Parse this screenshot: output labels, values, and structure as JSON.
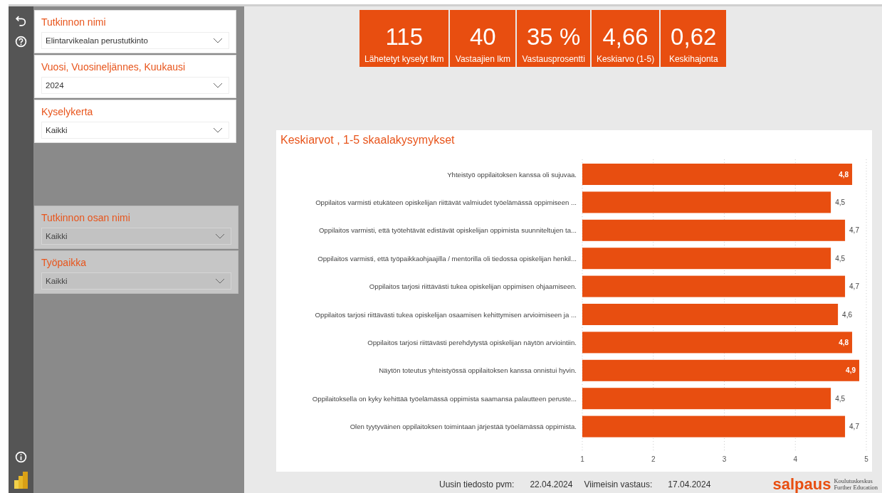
{
  "filters": {
    "top": [
      {
        "title": "Tutkinnon nimi",
        "value": "Elintarvikealan perustutkinto",
        "disabled": false
      },
      {
        "title": "Vuosi, Vuosineljännes, Kuukausi",
        "value": "2024",
        "disabled": false
      },
      {
        "title": "Kyselykerta",
        "value": "Kaikki",
        "disabled": false
      }
    ],
    "bottom": [
      {
        "title": "Tutkinnon osan nimi",
        "value": "Kaikki",
        "disabled": true
      },
      {
        "title": "Työpaikka",
        "value": "Kaikki",
        "disabled": true
      }
    ]
  },
  "kpis": [
    {
      "value": "115",
      "label": "Lähetetyt kyselyt lkm"
    },
    {
      "value": "40",
      "label": "Vastaajien lkm"
    },
    {
      "value": "35 %",
      "label": "Vastausprosentti"
    },
    {
      "value": "4,66",
      "label": "Keskiarvo (1-5)"
    },
    {
      "value": "0,62",
      "label": "Keskihajonta"
    }
  ],
  "chart": {
    "title": "Keskiarvot , 1-5 skaalakysymykset",
    "chart_data": {
      "type": "bar",
      "orientation": "horizontal",
      "grid": true,
      "xlim": [
        1,
        5
      ],
      "xticks": [
        1,
        2,
        3,
        4,
        5
      ],
      "categories": [
        "Yhteistyö oppilaitoksen kanssa oli sujuvaa.",
        "Oppilaitos varmisti etukäteen opiskelijan riittävät valmiudet työelämässä oppimiseen ...",
        "Oppilaitos varmisti, että työtehtävät edistävät opiskelijan oppimista suunniteltujen ta...",
        "Oppilaitos varmisti, että työpaikkaohjaajilla / mentorilla oli tiedossa opiskelijan henkil...",
        "Oppilaitos tarjosi riittävästi tukea opiskelijan oppimisen ohjaamiseen.",
        "Oppilaitos tarjosi riittävästi tukea opiskelijan osaamisen kehittymisen arvioimiseen ja ...",
        "Oppilaitos tarjosi riittävästi perehdytystä opiskelijan näytön arviointiin.",
        "Näytön toteutus yhteistyössä oppilaitoksen kanssa onnistui hyvin.",
        "Oppilaitoksella on kyky kehittää työelämässä oppimista saamansa palautteen peruste...",
        "Olen tyytyväinen oppilaitoksen toimintaan järjestää työelämässä oppimista."
      ],
      "series": [
        {
          "color": "#e84e10",
          "values": [
            4.8,
            4.5,
            4.7,
            4.5,
            4.7,
            4.6,
            4.8,
            4.9,
            4.5,
            4.7
          ]
        }
      ],
      "value_labels": [
        "4,8",
        "4,5",
        "4,7",
        "4,5",
        "4,7",
        "4,6",
        "4,8",
        "4,9",
        "4,5",
        "4,7"
      ]
    }
  },
  "footer": [
    {
      "label": "Uusin tiedosto pvm:",
      "value": "22.04.2024"
    },
    {
      "label": "Viimeisin vastaus:",
      "value": "17.04.2024"
    }
  ],
  "logo": {
    "name": "salpaus",
    "line1": "Koulutuskeskus",
    "line2": "Further Education"
  }
}
